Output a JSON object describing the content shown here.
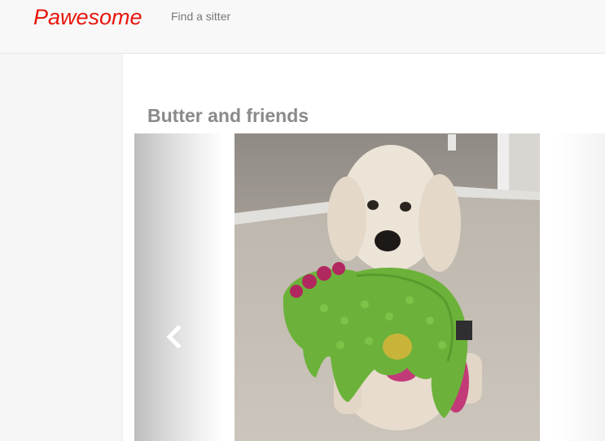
{
  "header": {
    "brand": "Pawesome",
    "nav": [
      {
        "label": "Find a sitter"
      }
    ]
  },
  "main": {
    "title": "Butter and friends",
    "carousel": {
      "prev_icon": "chevron-left-icon",
      "image_subject": "dog-holding-green-plush-toy"
    }
  },
  "colors": {
    "brand": "#e8150c",
    "nav_text": "#777777",
    "title_text": "#8a8a8a",
    "topbar_bg": "#f8f8f8",
    "sidebar_bg": "#f5f5f5"
  }
}
